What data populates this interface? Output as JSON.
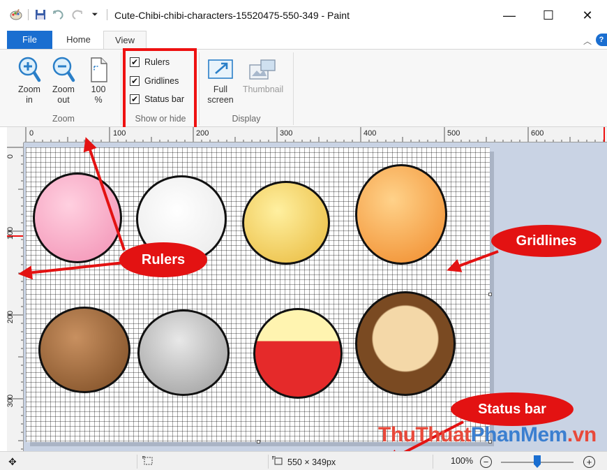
{
  "window": {
    "title": "Cute-Chibi-chibi-characters-15520475-550-349 - Paint",
    "minimize": "—",
    "maximize": "☐",
    "close": "✕"
  },
  "tabs": [
    {
      "label": "File"
    },
    {
      "label": "Home"
    },
    {
      "label": "View"
    }
  ],
  "ribbon": {
    "zoom_group": {
      "label": "Zoom",
      "zoom_in": {
        "line1": "Zoom",
        "line2": "in"
      },
      "zoom_out": {
        "line1": "Zoom",
        "line2": "out"
      },
      "hundred": {
        "line1": "100",
        "line2": "%"
      }
    },
    "show_hide_group": {
      "label": "Show or hide",
      "rulers": {
        "label": "Rulers",
        "checked": true
      },
      "gridlines": {
        "label": "Gridlines",
        "checked": true
      },
      "status_bar": {
        "label": "Status bar",
        "checked": true
      }
    },
    "display_group": {
      "label": "Display",
      "full_screen": {
        "line1": "Full",
        "line2": "screen"
      },
      "thumbnail": {
        "label": "Thumbnail"
      }
    }
  },
  "rulers": {
    "horizontal_labels": [
      "0",
      "100",
      "200",
      "300",
      "400",
      "500",
      "600"
    ],
    "vertical_labels": [
      "0",
      "100",
      "200",
      "300"
    ]
  },
  "annotations": {
    "rulers": "Rulers",
    "gridlines": "Gridlines",
    "status_bar": "Status bar"
  },
  "watermark": {
    "part1": "ThuThuat",
    "part2": "PhanMem",
    "part3": ".vn"
  },
  "status_bar": {
    "image_size": "550 × 349px",
    "zoom": "100%"
  },
  "colors": {
    "file_tab": "#1a6ed0",
    "annotation_red": "#e31212",
    "workspace": "#c9d3e4"
  }
}
